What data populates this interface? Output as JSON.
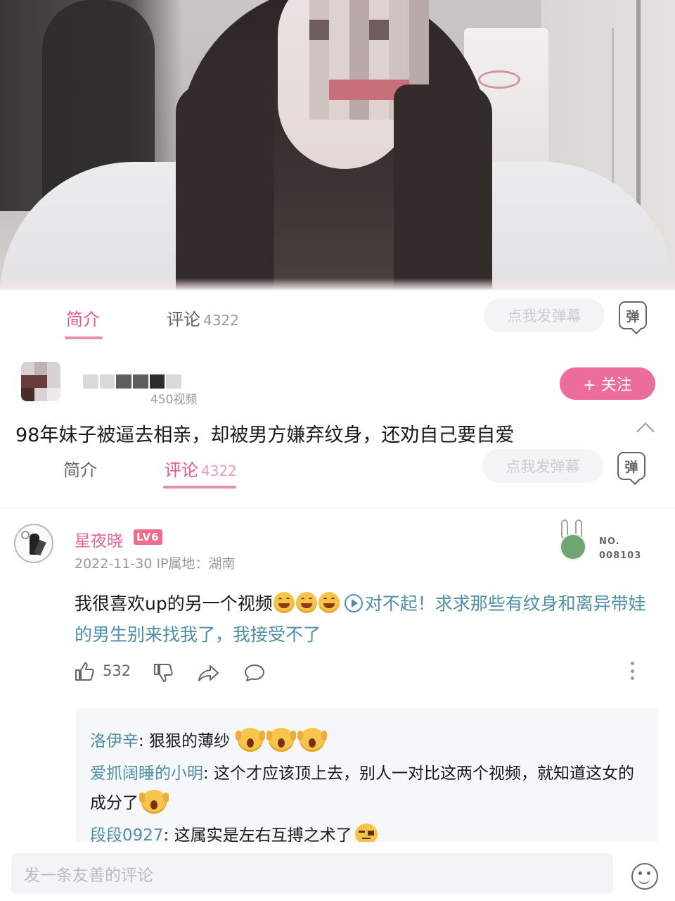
{
  "tabs_top": {
    "intro_label": "简介",
    "comments_label": "评论",
    "comments_count": "4322",
    "danmaku_placeholder": "点我发弹幕",
    "danmaku_button": "弹"
  },
  "uploader": {
    "meta": "450视频",
    "follow_label": "+ 关注"
  },
  "video": {
    "title": "98年妹子被逼去相亲，却被男方嫌弃纹身，还劝自己要自爱"
  },
  "tabs_sticky": {
    "intro_label": "简介",
    "comments_label": "评论",
    "comments_count": "4322",
    "danmaku_placeholder": "点我发弹幕",
    "danmaku_button": "弹"
  },
  "comment": {
    "author": "星夜晓",
    "level": "LV6",
    "date_location": "2022-11-30  IP属地：湖南",
    "fan_no_label": "NO.",
    "fan_no_value": "008103",
    "text_start": "我很喜欢up的另一个视频",
    "text_link": "对不起！求求那些有纹身和离异带娃的男生别来找我了，我接受不了",
    "like_count": "532"
  },
  "replies": [
    {
      "name": "洛伊辛",
      "text": ": 狠狠的薄纱"
    },
    {
      "name": "爱抓阔睡的小明",
      "text": ": 这个才应该顶上去，别人一对比这两个视频，就知道这女的成分了"
    },
    {
      "name": "段段0927",
      "text": ": 这属实是左右互搏之术了"
    }
  ],
  "bottom": {
    "input_placeholder": "发一条友善的评论"
  },
  "colors": {
    "accent_pink": "#e05a8a",
    "follow_pink": "#ec6d9a",
    "link_teal": "#4d8fa8"
  }
}
